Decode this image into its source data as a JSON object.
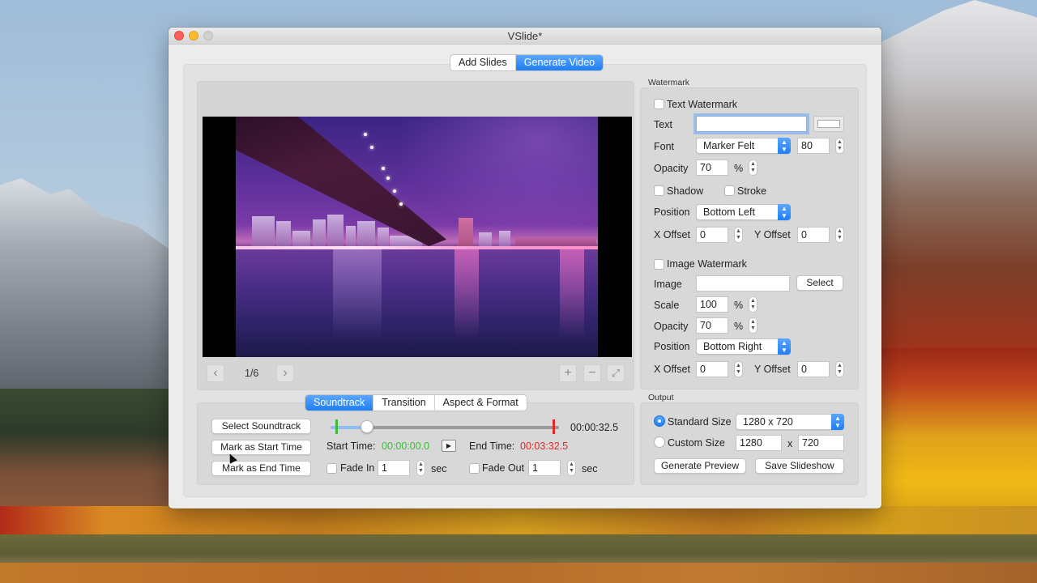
{
  "window": {
    "title": "VSlide*"
  },
  "main_tabs": [
    {
      "label": "Add Slides",
      "active": false
    },
    {
      "label": "Generate Video",
      "active": true
    }
  ],
  "preview": {
    "page_indicator": "1/6",
    "prev_icon": "chevron-left-icon",
    "next_icon": "chevron-right-icon",
    "zoom_in_icon": "plus-icon",
    "zoom_out_icon": "minus-icon",
    "fullscreen_icon": "expand-icon",
    "prev_glyph": "‹",
    "next_glyph": "›",
    "plus_glyph": "+",
    "minus_glyph": "−",
    "expand_glyph": "⤢"
  },
  "sub_tabs": [
    {
      "label": "Soundtrack",
      "active": true
    },
    {
      "label": "Transition",
      "active": false
    },
    {
      "label": "Aspect & Format",
      "active": false
    }
  ],
  "soundtrack": {
    "select_button": "Select Soundtrack",
    "mark_start_button": "Mark as Start Time",
    "mark_end_button": "Mark as End Time",
    "position_fraction": 0.16,
    "start_marker_fraction": 0.02,
    "end_marker_fraction": 0.97,
    "current_time": "00:00:32.5",
    "start_time_label": "Start Time:",
    "start_time_value": "00:00:00.0",
    "end_time_label": "End Time:",
    "end_time_value": "00:03:32.5",
    "play_glyph": "▶",
    "fade_in_label": "Fade In",
    "fade_in_value": "1",
    "fade_in_checked": false,
    "fade_out_label": "Fade Out",
    "fade_out_value": "1",
    "fade_out_checked": false,
    "sec_unit": "sec",
    "colors": {
      "start": "#3dbb3d",
      "end": "#e02828",
      "fill": "#8fbcf1"
    }
  },
  "watermark": {
    "group_label": "Watermark",
    "text_watermark_label": "Text Watermark",
    "text_watermark_checked": false,
    "text_label": "Text",
    "text_value": "",
    "font_label": "Font",
    "font_value": "Marker Felt",
    "font_size": "80",
    "opacity_label": "Opacity",
    "text_opacity": "70",
    "percent": "%",
    "shadow_label": "Shadow",
    "stroke_label": "Stroke",
    "position_label": "Position",
    "text_position": "Bottom Left",
    "x_offset_label": "X Offset",
    "y_offset_label": "Y Offset",
    "text_x_offset": "0",
    "text_y_offset": "0",
    "image_watermark_label": "Image Watermark",
    "image_watermark_checked": false,
    "image_label": "Image",
    "image_value": "",
    "select_button": "Select",
    "scale_label": "Scale",
    "scale_value": "100",
    "image_opacity": "70",
    "image_position": "Bottom Right",
    "image_x_offset": "0",
    "image_y_offset": "0",
    "text_color": "#ffffff"
  },
  "output": {
    "group_label": "Output",
    "standard_size_label": "Standard Size",
    "standard_size_selected": true,
    "standard_size_value": "1280 x 720",
    "custom_size_label": "Custom Size",
    "custom_width": "1280",
    "custom_height": "720",
    "x_sep": "x",
    "generate_preview_button": "Generate Preview",
    "save_slideshow_button": "Save Slideshow"
  },
  "glyphs": {
    "stepper": "⌃⌄",
    "popup_arrow": "⇕"
  }
}
